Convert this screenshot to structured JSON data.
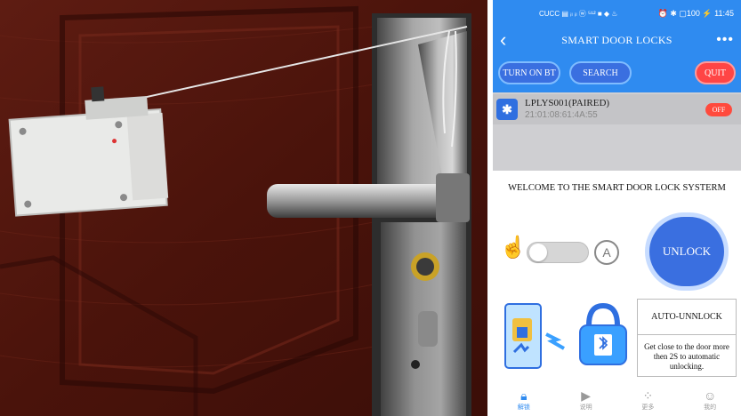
{
  "status_bar": {
    "carrier": "CUCC",
    "icons_text": "▤ ᵢₗ ᵢₗ ⓦ ⁵¹² ■ ◆ ♨",
    "right_text": "⏰ ✱ ▢100 ⚡ 11:45"
  },
  "app_bar": {
    "title": "SMART DOOR LOCKS",
    "back_icon": "chevron-left-icon",
    "more_icon": "more-dots-icon"
  },
  "buttons": {
    "turn_on_bt": "TURN ON BT",
    "search": "SEARCH",
    "quit": "QUIT"
  },
  "device": {
    "name": "LPLYS001(PAIRED)",
    "mac": "21:01:08:61:4A:55",
    "state_button": "OFF"
  },
  "welcome_text": "WELCOME TO THE SMART DOOR LOCK SYSTERM",
  "controls": {
    "unlock_label": "UNLOCK",
    "auto_letter": "A"
  },
  "auto_panel": {
    "title": "AUTO-UNNLOCK",
    "description": "Get close to the door more then 2S to automatic unlocking."
  },
  "tabs": [
    {
      "label": "解锁",
      "icon": "lock-icon"
    },
    {
      "label": "说明",
      "icon": "play-icon"
    },
    {
      "label": "更多",
      "icon": "grid-icon"
    },
    {
      "label": "我的",
      "icon": "user-icon"
    }
  ],
  "colors": {
    "primary": "#2f8bf0",
    "button_blue": "#3a6fe0",
    "quit_red": "#ff4545",
    "door_brown": "#5a1a10"
  }
}
